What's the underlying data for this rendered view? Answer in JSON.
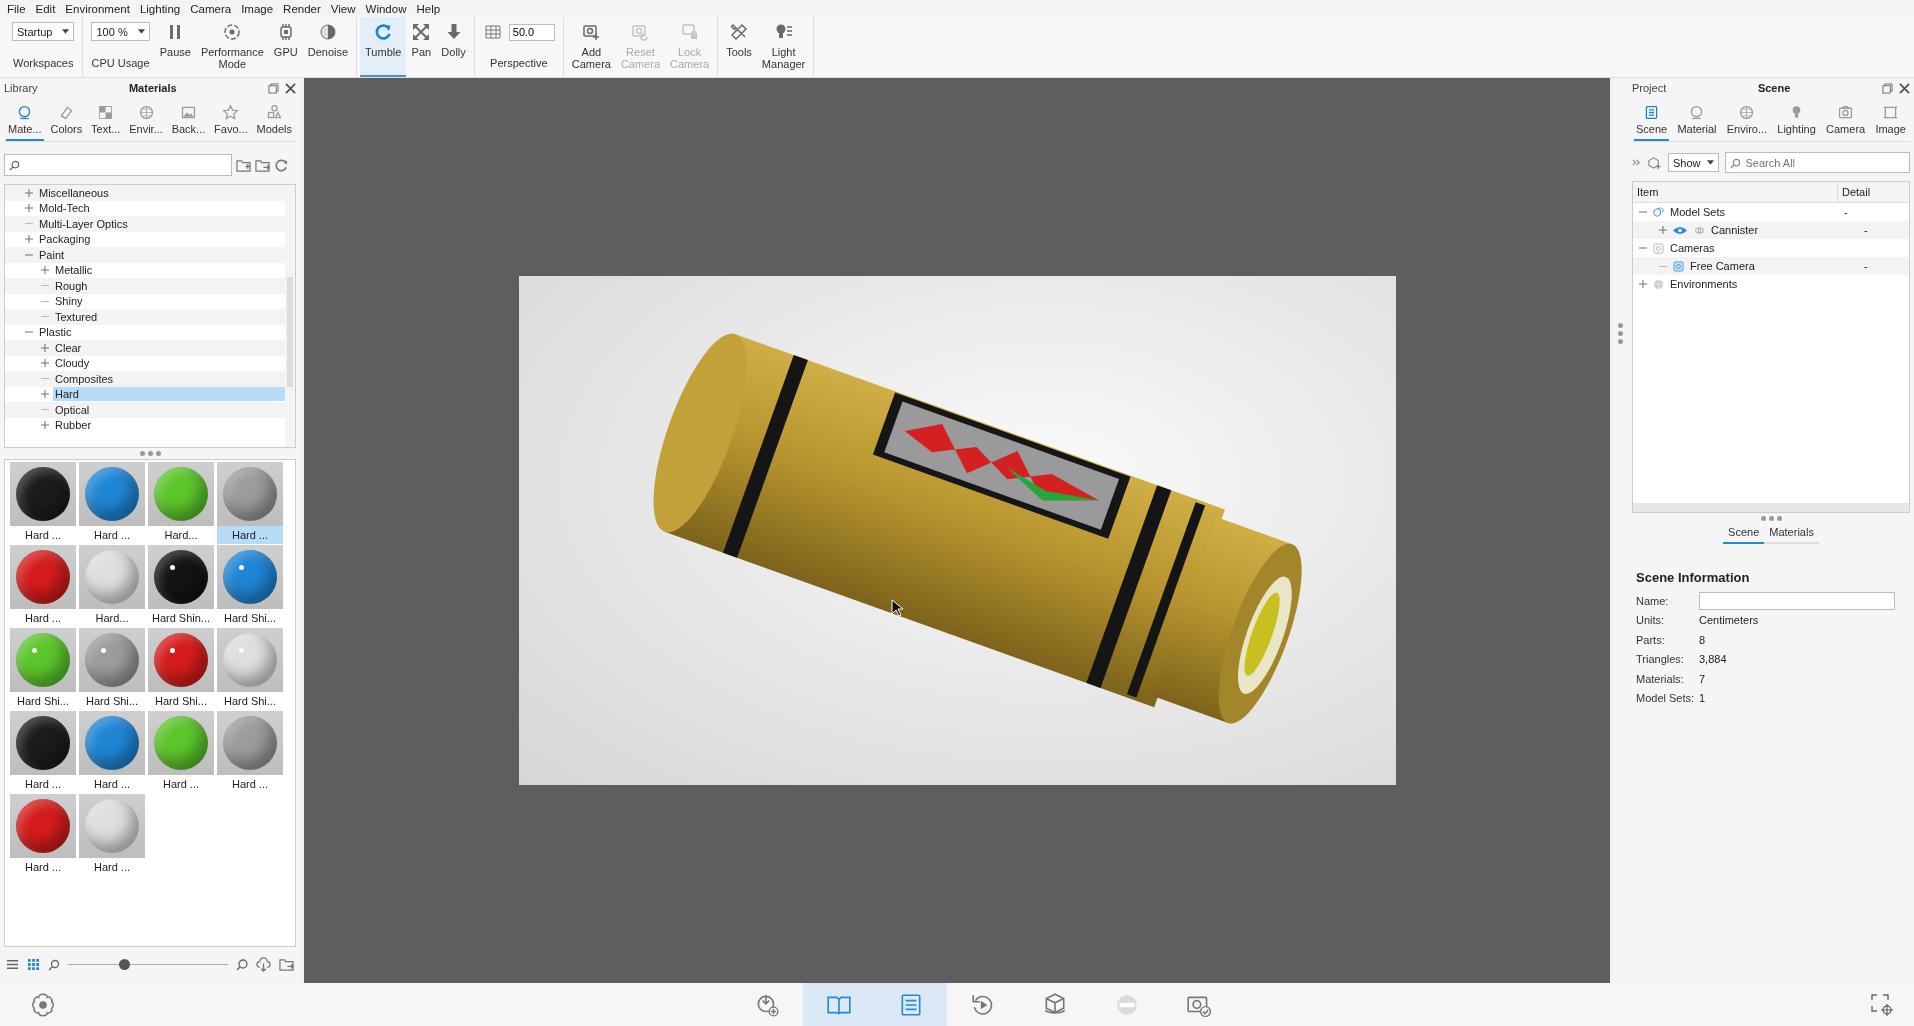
{
  "menu": [
    "File",
    "Edit",
    "Environment",
    "Lighting",
    "Camera",
    "Image",
    "Render",
    "View",
    "Window",
    "Help"
  ],
  "toolbar": [
    [
      {
        "kind": "dropdown",
        "value": "Startup",
        "label": "Workspaces"
      }
    ],
    [
      {
        "kind": "dropdown",
        "value": "100 %",
        "label": "CPU Usage"
      },
      {
        "kind": "button",
        "label": "Pause",
        "selected": false,
        "disabled": false
      },
      {
        "kind": "button",
        "label": "Performance Mode",
        "selected": false,
        "disabled": false
      },
      {
        "kind": "button",
        "label": "GPU",
        "selected": false,
        "disabled": false
      },
      {
        "kind": "button",
        "label": "Denoise",
        "selected": false,
        "disabled": false
      }
    ],
    [
      {
        "kind": "button",
        "label": "Tumble",
        "selected": true,
        "disabled": false
      },
      {
        "kind": "button",
        "label": "Pan",
        "selected": false,
        "disabled": false
      },
      {
        "kind": "button",
        "label": "Dolly",
        "selected": false,
        "disabled": false
      }
    ],
    [
      {
        "kind": "field",
        "value": "50.0",
        "label": "Perspective"
      }
    ],
    [
      {
        "kind": "button",
        "label": "Add Camera",
        "selected": false,
        "disabled": false
      },
      {
        "kind": "button",
        "label": "Reset Camera",
        "selected": false,
        "disabled": true
      },
      {
        "kind": "button",
        "label": "Lock Camera",
        "selected": false,
        "disabled": true
      }
    ],
    [
      {
        "kind": "button",
        "label": "Tools",
        "selected": false,
        "disabled": false
      },
      {
        "kind": "button",
        "label": "Light Manager",
        "selected": false,
        "disabled": false
      }
    ]
  ],
  "library": {
    "title": "Library",
    "heading": "Materials",
    "tabs": [
      {
        "label": "Mate...",
        "selected": true
      },
      {
        "label": "Colors",
        "selected": false
      },
      {
        "label": "Text...",
        "selected": false
      },
      {
        "label": "Envir...",
        "selected": false
      },
      {
        "label": "Back...",
        "selected": false
      },
      {
        "label": "Favo...",
        "selected": false
      },
      {
        "label": "Models",
        "selected": false
      }
    ],
    "tree": [
      {
        "label": "Miscellaneous",
        "expanded": false,
        "selected": false
      },
      {
        "label": "Mold-Tech",
        "expanded": false,
        "selected": false
      },
      {
        "label": "Multi-Layer Optics",
        "selected": false
      },
      {
        "label": "Packaging",
        "expanded": false,
        "selected": false
      },
      {
        "label": "Paint",
        "expanded": true,
        "selected": false,
        "children": [
          {
            "label": "Metallic",
            "expanded": false,
            "selected": false
          },
          {
            "label": "Rough",
            "selected": false
          },
          {
            "label": "Shiny",
            "selected": false
          },
          {
            "label": "Textured",
            "selected": false
          }
        ]
      },
      {
        "label": "Plastic",
        "expanded": true,
        "selected": false,
        "children": [
          {
            "label": "Clear",
            "expanded": false,
            "selected": false
          },
          {
            "label": "Cloudy",
            "expanded": false,
            "selected": false
          },
          {
            "label": "Composites",
            "selected": false
          },
          {
            "label": "Hard",
            "expanded": false,
            "selected": true
          },
          {
            "label": "Optical",
            "selected": false
          },
          {
            "label": "Rubber",
            "expanded": false,
            "selected": false
          }
        ]
      }
    ],
    "swatches": [
      {
        "label": "Hard ...",
        "color": "#1c1c1c",
        "kind": "matte",
        "selected": false
      },
      {
        "label": "Hard ...",
        "color": "#1f86d6",
        "kind": "matte",
        "selected": false
      },
      {
        "label": "Hard...",
        "color": "#5cc62a",
        "kind": "matte",
        "selected": false
      },
      {
        "label": "Hard ...",
        "color": "#9c9c9c",
        "kind": "matte",
        "selected": true
      },
      {
        "label": "Hard ...",
        "color": "#d61c1c",
        "kind": "matte",
        "selected": false
      },
      {
        "label": "Hard...",
        "color": "#dedede",
        "kind": "matte",
        "selected": false
      },
      {
        "label": "Hard Shin...",
        "color": "#141414",
        "kind": "shiny",
        "selected": false
      },
      {
        "label": "Hard Shi...",
        "color": "#1f86d6",
        "kind": "shiny",
        "selected": false
      },
      {
        "label": "Hard Shi...",
        "color": "#5cc62a",
        "kind": "shiny",
        "selected": false
      },
      {
        "label": "Hard Shi...",
        "color": "#9c9c9c",
        "kind": "shiny",
        "selected": false
      },
      {
        "label": "Hard Shi...",
        "color": "#d61c1c",
        "kind": "shiny",
        "selected": false
      },
      {
        "label": "Hard Shi...",
        "color": "#dedede",
        "kind": "shiny",
        "selected": false
      },
      {
        "label": "Hard ...",
        "color": "#1c1c1c",
        "kind": "matte",
        "selected": false
      },
      {
        "label": "Hard ...",
        "color": "#1f86d6",
        "kind": "matte",
        "selected": false
      },
      {
        "label": "Hard ...",
        "color": "#5cc62a",
        "kind": "matte",
        "selected": false
      },
      {
        "label": "Hard ...",
        "color": "#9c9c9c",
        "kind": "matte",
        "selected": false
      },
      {
        "label": "Hard ...",
        "color": "#d61c1c",
        "kind": "matte",
        "selected": false
      },
      {
        "label": "Hard ...",
        "color": "#dedede",
        "kind": "matte",
        "selected": false
      }
    ],
    "view_modes": [
      {
        "kind": "list",
        "selected": false
      },
      {
        "kind": "grid",
        "selected": true
      }
    ],
    "zoom": {
      "level": 0.35
    }
  },
  "project": {
    "title": "Project",
    "heading": "Scene",
    "tabs": [
      {
        "label": "Scene",
        "selected": true
      },
      {
        "label": "Material",
        "selected": false
      },
      {
        "label": "Enviro...",
        "selected": false
      },
      {
        "label": "Lighting",
        "selected": false
      },
      {
        "label": "Camera",
        "selected": false
      },
      {
        "label": "Image",
        "selected": false
      }
    ],
    "show": "Show",
    "search": {
      "placeholder": "Search All"
    },
    "columns": [
      "Item",
      "Detail"
    ],
    "tree": [
      {
        "kind": "modelset",
        "label": "Model Sets",
        "detail": "-",
        "expanded": true,
        "children": [
          {
            "kind": "model",
            "label": "Cannister",
            "detail": "-",
            "expanded": false
          }
        ]
      },
      {
        "kind": "cameras",
        "label": "Cameras",
        "expanded": true,
        "children": [
          {
            "kind": "camera",
            "label": "Free Camera",
            "detail": "-"
          }
        ]
      },
      {
        "kind": "environments",
        "label": "Environments",
        "expanded": false
      }
    ],
    "bottom_tabs": [
      {
        "label": "Scene",
        "selected": true
      },
      {
        "label": "Materials",
        "selected": false
      }
    ],
    "info": {
      "title": "Scene Information",
      "name_label": "Name:",
      "rows": [
        {
          "label": "Units:",
          "value": "Centimeters"
        },
        {
          "label": "Parts:",
          "value": "8"
        },
        {
          "label": "Triangles:",
          "value": "3,884"
        },
        {
          "label": "Materials:",
          "value": "7"
        },
        {
          "label": "Model Sets:",
          "value": "1"
        }
      ]
    }
  },
  "dock": [
    {
      "kind": "import",
      "selected": false,
      "disabled": false
    },
    {
      "kind": "book",
      "selected": true,
      "disabled": false
    },
    {
      "kind": "list",
      "selected": true,
      "disabled": false
    },
    {
      "kind": "replay",
      "selected": false,
      "disabled": false
    },
    {
      "kind": "cube",
      "selected": false,
      "disabled": false
    },
    {
      "kind": "sphere",
      "selected": false,
      "disabled": true
    },
    {
      "kind": "camera",
      "selected": false,
      "disabled": false
    }
  ]
}
